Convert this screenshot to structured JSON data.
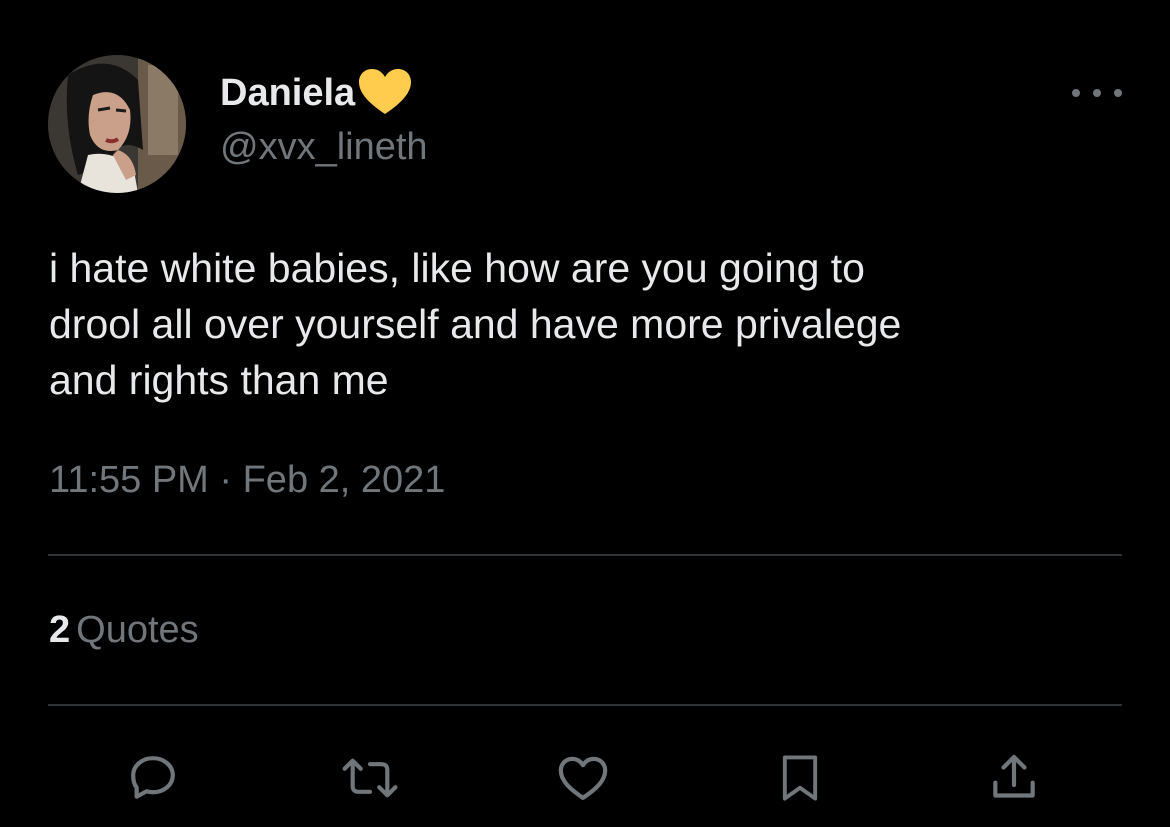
{
  "author": {
    "display_name": "Daniela",
    "badge_emoji": "yellow-heart",
    "handle": "@xvx_lineth"
  },
  "tweet": {
    "lines": [
      "i hate white babies, like how are you going to",
      "drool all over yourself and have more privalege",
      "and rights than me"
    ],
    "timestamp": "11:55 PM · Feb 2, 2021"
  },
  "stats": {
    "quotes_count": "2",
    "quotes_label": "Quotes"
  },
  "actions": [
    {
      "icon": "reply-icon"
    },
    {
      "icon": "retweet-icon"
    },
    {
      "icon": "like-icon"
    },
    {
      "icon": "bookmark-icon"
    },
    {
      "icon": "share-icon"
    }
  ],
  "colors": {
    "background": "#000000",
    "text_primary": "#e7e9ea",
    "text_secondary": "#71767b",
    "divider": "#2f3336",
    "heart": "#ffcc4d"
  }
}
